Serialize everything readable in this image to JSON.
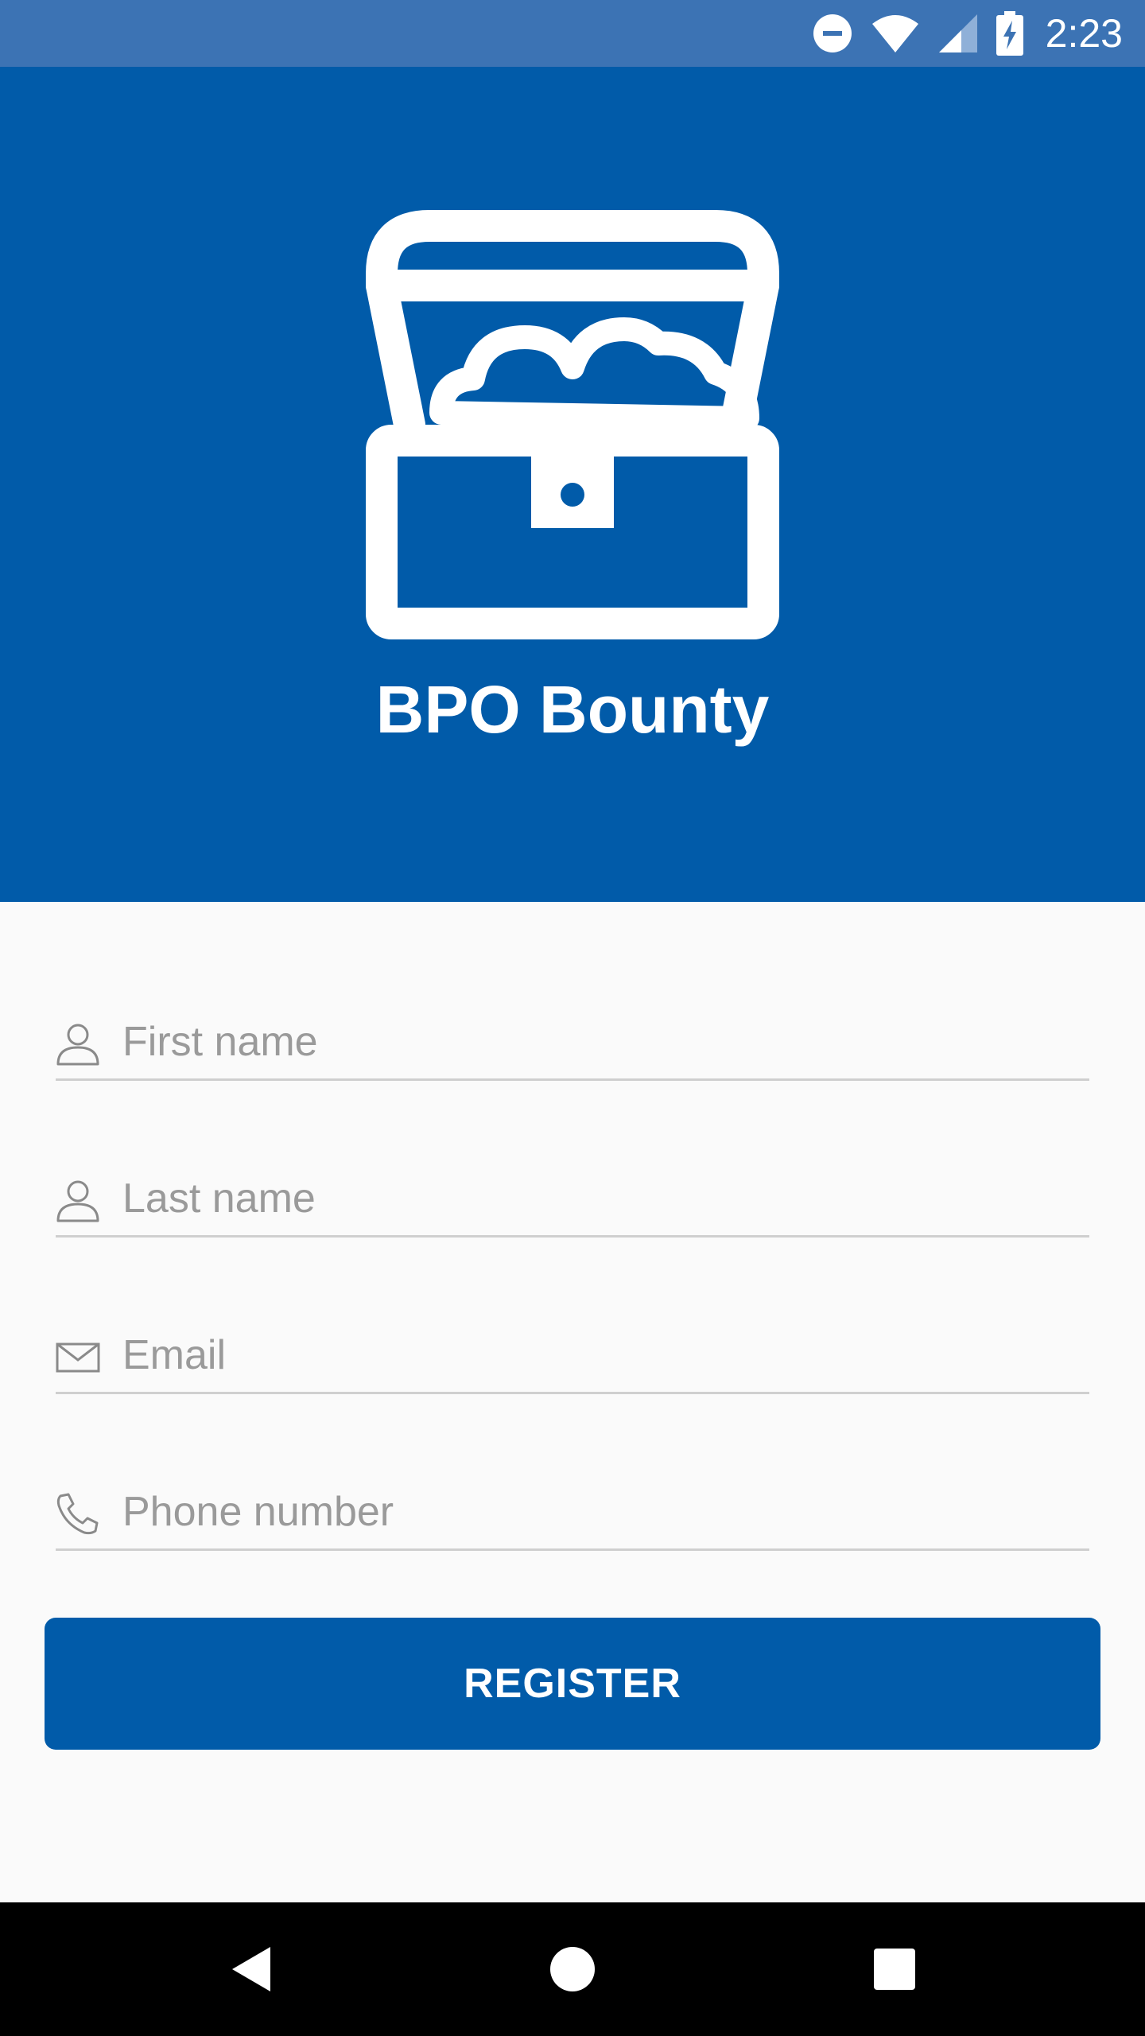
{
  "status_bar": {
    "time": "2:23",
    "icons": [
      "do-not-disturb-icon",
      "wifi-icon",
      "cell-signal-icon",
      "battery-charging-icon"
    ]
  },
  "header": {
    "logo": "treasure-chest-icon",
    "title": "BPO Bounty",
    "background_color": "#015ba9"
  },
  "form": {
    "first_name": {
      "icon": "person-icon",
      "placeholder": "First name",
      "value": ""
    },
    "last_name": {
      "icon": "person-icon",
      "placeholder": "Last name",
      "value": ""
    },
    "email": {
      "icon": "envelope-icon",
      "placeholder": "Email",
      "value": ""
    },
    "phone": {
      "icon": "phone-icon",
      "placeholder": "Phone number",
      "value": ""
    },
    "register_label": "REGISTER"
  },
  "nav_bar": {
    "buttons": [
      "back-icon",
      "home-icon",
      "recents-icon"
    ]
  }
}
